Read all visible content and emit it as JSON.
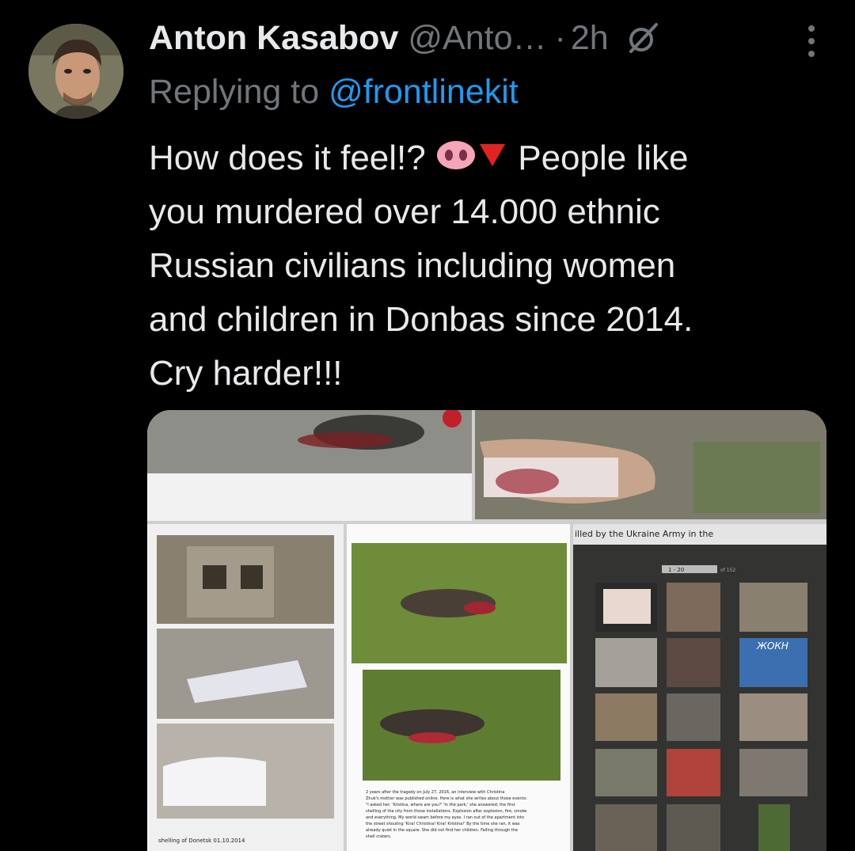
{
  "tweet": {
    "author_name": "Anton Kasabov",
    "author_handle": "@Anto…",
    "separator": "·",
    "time": "2h",
    "replying_prefix": "Replying to ",
    "replying_to": "@frontlinekit",
    "text_lines": [
      "How does it feel!?",
      "People like",
      "you murdered over 14.000 ethnic",
      "Russian civilians including women",
      "and children in Donbas since 2014.",
      "Cry harder!!!"
    ],
    "icons": {
      "grok": "grok-icon",
      "more": "more-options-icon",
      "pig": "pig-nose-emoji",
      "triangle": "red-triangle-down-emoji"
    }
  },
  "media": {
    "caption_top": "illed by the Ukraine Army in the",
    "pager": "1 - 20",
    "pager_total": "of 152",
    "banner_text": "ЖОКН",
    "caption_left": "shelling of Donetsk 01.10.2014",
    "caption_middle_lines": [
      "2 years after the tragedy on July 27, 2016, an interview with Christina",
      "Zhuk's mother was published online. Here is what she writes about those events:",
      "\"I asked her: 'Kristina, where are you?' 'In the park,' she answered; the first",
      "shelling of the city from those installations. Explosion after explosion, fire, smoke",
      "and everything. My world swam before my eyes. I ran out of the apartment into",
      "the street shouting 'Kira! Christina! Kira! Kristina!' By the time she ran, it was",
      "already quiet in the square. She did not find her children. Falling through the",
      "shell craters."
    ]
  },
  "colors": {
    "background": "#000000",
    "text": "#e7e9ea",
    "muted": "#71767b",
    "link": "#1d9bf0"
  }
}
